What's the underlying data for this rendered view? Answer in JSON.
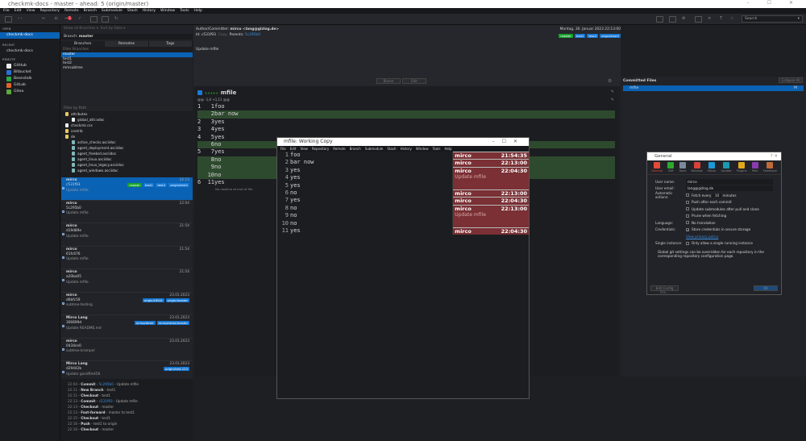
{
  "window": {
    "title": "checkmk-docs - master - ahead: 5 (origin/master)",
    "controls": "– ☐ ✕"
  },
  "menu": [
    "File",
    "Edit",
    "View",
    "Repository",
    "Remote",
    "Branch",
    "Submodule",
    "Stash",
    "History",
    "Window",
    "Tools",
    "Help"
  ],
  "toolbar": {
    "search_placeholder": "Search",
    "badge": "5"
  },
  "sidebar": {
    "open_header": "Open",
    "open_items": [
      "checkmk-docs"
    ],
    "recent_header": "Recent",
    "recent_items": [
      "checkmk-docs"
    ],
    "remote_header": "Remote",
    "remotes": [
      {
        "label": "GitHub",
        "color": "#eeeeee"
      },
      {
        "label": "Bitbucket",
        "color": "#2a6fd6"
      },
      {
        "label": "Beanstalk",
        "color": "#2aa84a"
      },
      {
        "label": "GitLab",
        "color": "#e2632b"
      },
      {
        "label": "Gitea",
        "color": "#5ca83a"
      }
    ]
  },
  "branches": {
    "show_all": "Show all Branches ▾",
    "sort": "Sort by Date ▾",
    "branch_label": "Branch:",
    "branch_value": "master",
    "tabs": [
      "Branches",
      "Remotes",
      "Tags"
    ],
    "filter_placeholder": "Filter Branches",
    "items": [
      "master",
      "test1",
      "test2",
      "mmsubtree"
    ]
  },
  "files": {
    "filter_placeholder": "Filter by Path",
    "tree": [
      {
        "name": "attributes",
        "type": "folder",
        "level": 0
      },
      {
        "name": "global_attr.adoc",
        "type": "file",
        "level": 1
      },
      {
        "name": "checkmk.css",
        "type": "file",
        "level": 0
      },
      {
        "name": "contrib",
        "type": "folder",
        "level": 0
      },
      {
        "name": "de",
        "type": "folder",
        "level": 0
      },
      {
        "name": "active_checks.asciidoc",
        "type": "doc",
        "level": 1
      },
      {
        "name": "agent_deployment.asciidoc",
        "type": "doc",
        "level": 1
      },
      {
        "name": "agent_freebsd.asciidoc",
        "type": "doc",
        "level": 1
      },
      {
        "name": "agent_linux.asciidoc",
        "type": "doc",
        "level": 1
      },
      {
        "name": "agent_linux_legacy.asciidoc",
        "type": "doc",
        "level": 1
      },
      {
        "name": "agent_windows.asciidoc",
        "type": "doc",
        "level": 1
      }
    ]
  },
  "commits": [
    {
      "author": "mirco",
      "hash": "c531f93",
      "msg": "Update mfile",
      "time": "22:13",
      "badges": [
        "master",
        "test1",
        "test2",
        "origin/test2"
      ]
    },
    {
      "author": "mirco",
      "hash": "5c295b0",
      "msg": "Update mfile",
      "time": "22:04",
      "badges": []
    },
    {
      "author": "mirco",
      "hash": "d19d89e",
      "msg": "Update mfile",
      "time": "21:54",
      "badges": []
    },
    {
      "author": "mirco",
      "hash": "61fc676",
      "msg": "Update mfile",
      "time": "21:54",
      "badges": []
    },
    {
      "author": "mirco",
      "hash": "a20ba05",
      "msg": "Update mfile",
      "time": "21:54",
      "badges": []
    },
    {
      "author": "mirco",
      "hash": "d6bfc59",
      "msg": "subtree-testing",
      "time": "23.01.2023",
      "badges": [
        "origin/HEAD",
        "origin/master"
      ]
    },
    {
      "author": "Mirco Lang",
      "hash": "300699d",
      "msg": "Update README.md",
      "time": "23.01.2023",
      "badges": [
        "mmsubtree",
        "mmsubtree/master"
      ]
    },
    {
      "author": "mirco",
      "hash": "0434ce0",
      "msg": "subtree-krampel",
      "time": "23.01.2023",
      "badges": []
    },
    {
      "author": "Mirco Lang",
      "hash": "d29442b",
      "msg": "Update goodfile456",
      "time": "23.01.2023",
      "badges": [
        "origin/test-123"
      ]
    }
  ],
  "log": [
    {
      "time": "22:04",
      "action": "Commit",
      "rest": " - Update mfile",
      "link": "5c295b0"
    },
    {
      "time": "22:11",
      "action": "New Branch",
      "rest": " - test1",
      "link": ""
    },
    {
      "time": "22:11",
      "action": "Checkout",
      "rest": " - test1",
      "link": ""
    },
    {
      "time": "22:13",
      "action": "Commit",
      "rest": " - Update mfile",
      "link": "c531f93"
    },
    {
      "time": "22:13",
      "action": "Checkout",
      "rest": " - master",
      "link": ""
    },
    {
      "time": "22:13",
      "action": "Fast-forward",
      "rest": " - master to test1",
      "link": ""
    },
    {
      "time": "22:15",
      "action": "Checkout",
      "rest": " - test1",
      "link": ""
    },
    {
      "time": "22:16",
      "action": "Push",
      "rest": " - test1 to origin",
      "link": ""
    },
    {
      "time": "22:16",
      "action": "Checkout",
      "rest": " - master",
      "link": ""
    }
  ],
  "details": {
    "author_label": "Author/Committer:",
    "author": "mirco <lang@gizlog.de>",
    "id_label": "Id:",
    "id": "c531f93",
    "copy": "Copy",
    "parents_label": "Parents:",
    "parent": "5c295b0",
    "date": "Montag, 30. Januar 2023 22:13:00",
    "badges": [
      "master",
      "test1",
      "test2",
      "origin/test2"
    ],
    "message": "Update mfile",
    "btn_blame": "Blame",
    "btn_edit": "Edit"
  },
  "diff": {
    "file": "mfile",
    "hunk": "@@ -1,6 +1,11 @@",
    "lines": [
      {
        "o": "1",
        "n": "1",
        "t": "foo",
        "a": false
      },
      {
        "o": "",
        "n": "2",
        "t": "bar now",
        "a": true
      },
      {
        "o": "2",
        "n": "3",
        "t": "yes",
        "a": false
      },
      {
        "o": "3",
        "n": "4",
        "t": "yes",
        "a": false
      },
      {
        "o": "4",
        "n": "5",
        "t": "yes",
        "a": false
      },
      {
        "o": "",
        "n": "6",
        "t": "no",
        "a": true
      },
      {
        "o": "5",
        "n": "7",
        "t": "yes",
        "a": false
      },
      {
        "o": "",
        "n": "8",
        "t": "no",
        "a": true
      },
      {
        "o": "",
        "n": "9",
        "t": "no",
        "a": true
      },
      {
        "o": "",
        "n": "10",
        "t": "no",
        "a": true
      },
      {
        "o": "6",
        "n": "11",
        "t": "yes",
        "a": false
      }
    ],
    "no_newline": "No newline at end of file"
  },
  "committed_files": {
    "title": "Committed Files",
    "collapse": "Collapse All",
    "items": [
      {
        "name": "mfile",
        "status": "M"
      }
    ]
  },
  "blame_window": {
    "title": "mfile: Working Copy",
    "lines": [
      "foo",
      "bar now",
      "yes",
      "yes",
      "yes",
      "no",
      "yes",
      "no",
      "no",
      "no",
      "yes"
    ],
    "blocks": [
      {
        "author": "mirco",
        "time": "21:54:35",
        "msg": "",
        "rows": 1
      },
      {
        "author": "mirco",
        "time": "22:13:00",
        "msg": "",
        "rows": 1
      },
      {
        "author": "mirco",
        "time": "22:04:30",
        "msg": "Update mfile",
        "rows": 3
      },
      {
        "author": "mirco",
        "time": "22:13:00",
        "msg": "",
        "rows": 1
      },
      {
        "author": "mirco",
        "time": "22:04:30",
        "msg": "",
        "rows": 1
      },
      {
        "author": "mirco",
        "time": "22:13:00",
        "msg": "Update mfile",
        "rows": 3
      },
      {
        "author": "mirco",
        "time": "22:04:30",
        "msg": "",
        "rows": 1
      }
    ]
  },
  "prefs": {
    "title": "General",
    "tabs": [
      {
        "label": "General",
        "color": "#e34a3a"
      },
      {
        "label": "Diff",
        "color": "#2da82d"
      },
      {
        "label": "Tools",
        "color": "#7a8a9a"
      },
      {
        "label": "Window",
        "color": "#d9413a"
      },
      {
        "label": "Editor",
        "color": "#1a9ad8"
      },
      {
        "label": "Update",
        "color": "#1a9ab0"
      },
      {
        "label": "Plugins",
        "color": "#e2a81a"
      },
      {
        "label": "Misc",
        "color": "#8a3ab0"
      },
      {
        "label": "Feedback",
        "color": "#c06a3a"
      }
    ],
    "user_name_label": "User name:",
    "user_name": "mirco",
    "user_email_label": "User email:",
    "user_email": "lang@gizlog.de",
    "auto_label": "Automatic actions:",
    "fetch_every": "Fetch every",
    "fetch_value": "10",
    "minutes": "minutes",
    "push_after": "Push after each commit",
    "update_sub": "Update submodules after pull and clone",
    "prune": "Prune when fetching",
    "language_label": "Language:",
    "language": "No translation",
    "cred_label": "Credentials:",
    "cred": "Store credentials in secure storage",
    "privacy": "View privacy policy",
    "single_label": "Single instance:",
    "single": "Only allow a single running instance",
    "note": "Global git settings can be overridden for each repository in the corresponding repository configuration page.",
    "edit_config": "Edit Config File...",
    "ok": "OK"
  }
}
